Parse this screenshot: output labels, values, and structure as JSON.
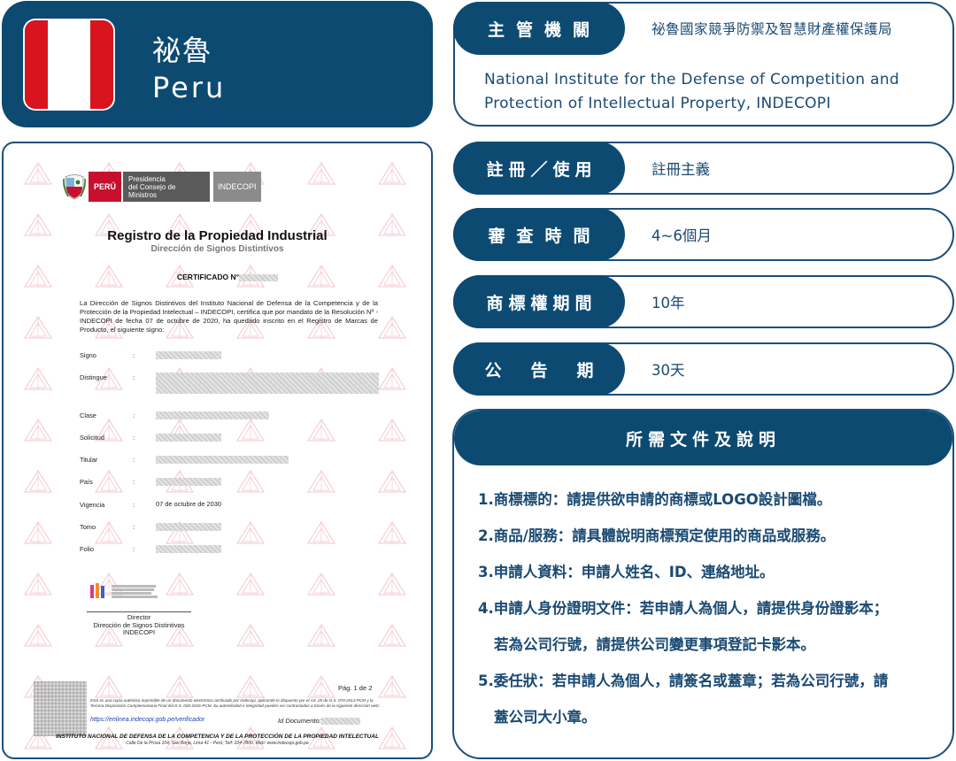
{
  "country": {
    "name_zh": "祕魯",
    "name_en": "Peru",
    "flag_colors": {
      "red": "#d8141e",
      "white": "#ffffff"
    },
    "flag_icon": "peru-flag-icon"
  },
  "certificate": {
    "header": {
      "peru_label": "PERÚ",
      "presidencia_line1": "Presidencia",
      "presidencia_line2": "del Consejo de Ministros",
      "agency_label": "INDECOPI"
    },
    "title": "Registro de la Propiedad Industrial",
    "subtitle": "Dirección de Signos Distintivos",
    "number_label": "CERTIFICADO N°",
    "intro": "La Dirección de Signos Distintivos del Instituto Nacional de Defensa de la Competencia y de la Protección de la Propiedad Intelectual – INDECOPI, certifica que por mandato de la Resolución Nº                               - INDECOPI de fecha 07 de octubre de 2020, ha quedado inscrito en el Registro de Marcas de Producto, el siguiente signo:",
    "fields": [
      {
        "label": "Signo",
        "value": ""
      },
      {
        "label": "Distingue",
        "value": ""
      },
      {
        "label": "Clase",
        "value": ""
      },
      {
        "label": "Solicitud",
        "value": ""
      },
      {
        "label": "Titular",
        "value": ""
      },
      {
        "label": "País",
        "value": ""
      },
      {
        "label": "Vigencia",
        "value": "07 de octubre de 2030"
      },
      {
        "label": "Tomo",
        "value": ""
      },
      {
        "label": "Folio",
        "value": ""
      }
    ],
    "colon": ":",
    "director_line1": "Director",
    "director_line2": "Dirección de Signos Distintivos",
    "director_line3": "INDECOPI",
    "page_number": "Pág. 1 de 2",
    "legal_note": "Esta es una copia auténtica imprimible de un documento electrónico archivado por Indecopi, aplicando lo dispuesto por el Art. 25 de D.S. 070-2013-PCM y la Tercera Disposición Complementaria Final del D.S. 026-2016-PCM. Su autenticidad e integridad pueden ser contrastadas a través de la siguiente dirección web:",
    "verify_url": "https://enlinea.indecopi.gob.pe/verificador",
    "document_id_label": "Id Documento:",
    "footer_institution": "INSTITUTO NACIONAL DE DEFENSA DE LA COMPETENCIA Y DE LA PROTECCIÓN DE LA PROPIEDAD INTELECTUAL",
    "footer_address": "Calle De la Prosa 104, San Borja, Lima 41 - Perú; Telf: 224-7800, Web: www.indecopi.gob.pe"
  },
  "authority": {
    "label": "主管機關",
    "name_zh": "祕魯國家競爭防禦及智慧財產權保護局",
    "name_en": "National Institute for the Defense of Competition and Protection of Intellectual Property, INDECOPI"
  },
  "rows": [
    {
      "label": "註冊／使用",
      "value": "註冊主義"
    },
    {
      "label": "審查時間",
      "value": "4~6個月"
    },
    {
      "label": "商標權期間",
      "value": "10年"
    },
    {
      "label": "公告期",
      "value": "30天"
    }
  ],
  "documents": {
    "title": "所需文件及說明",
    "lines": [
      "1.商標標的：請提供欲申請的商標或LOGO設計圖檔。",
      "2.商品/服務：請具體說明商標預定使用的商品或服務。",
      "3.申請人資料：申請人姓名、ID、連絡地址。",
      "4.申請人身份證明文件：若申請人為個人，請提供身份證影本；",
      "若為公司行號，請提供公司變更事項登記卡影本。",
      "5.委任狀：若申請人為個人，請簽名或蓋章；若為公司行號，請",
      "蓋公司大小章。"
    ]
  },
  "colors": {
    "primary_navy": "#0d4a72",
    "border_blue": "#1a4f7c",
    "text_blue": "#1a4a73",
    "flag_red": "#d8141e",
    "link_blue": "#1f3fb4"
  }
}
